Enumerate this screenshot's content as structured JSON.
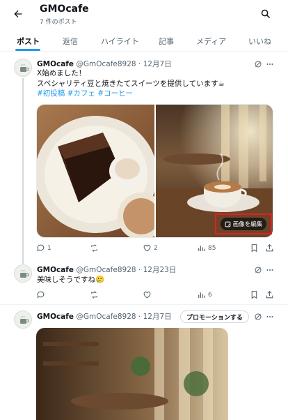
{
  "header": {
    "title": "GMOcafe",
    "post_count": "7 件のポスト"
  },
  "tabs": [
    {
      "label": "ポスト",
      "active": true
    },
    {
      "label": "返信",
      "active": false
    },
    {
      "label": "ハイライト",
      "active": false
    },
    {
      "label": "記事",
      "active": false
    },
    {
      "label": "メディア",
      "active": false
    },
    {
      "label": "いいね",
      "active": false
    }
  ],
  "posts": [
    {
      "name": "GMOcafe",
      "handle": "@GmOcafe8928",
      "date": "· 12月7日",
      "lines": [
        "X始めました！",
        "スペシャリティ豆と焼きたてスイーツを提供しています☕"
      ],
      "hashtags": "#初投稿 #カフェ #コーヒー",
      "edit_image_label": "画像を編集",
      "replies": "1",
      "reposts": "",
      "likes": "2",
      "views": "85"
    },
    {
      "name": "GMOcafe",
      "handle": "@GmOcafe8928",
      "date": "· 12月23日",
      "lines": [
        "美味しそうですね🥲"
      ],
      "replies": "",
      "reposts": "",
      "likes": "",
      "views": "6"
    },
    {
      "name": "GMOcafe",
      "handle": "@GmOcafe8928",
      "date": "· 12月7日",
      "promote_label": "プロモーションする"
    }
  ],
  "colors": {
    "accent": "#1d9bf0",
    "highlight_border": "#e0202a",
    "muted": "#536471"
  }
}
